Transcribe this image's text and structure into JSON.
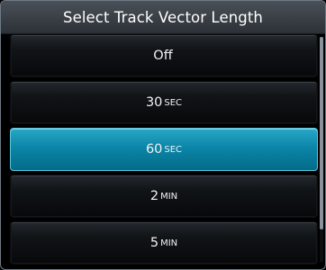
{
  "dialog": {
    "title": "Select Track Vector Length"
  },
  "options": [
    {
      "num": "Off",
      "unit": "",
      "selected": false
    },
    {
      "num": "30",
      "unit": "SEC",
      "selected": false
    },
    {
      "num": "60",
      "unit": "SEC",
      "selected": true
    },
    {
      "num": "2",
      "unit": "MIN",
      "selected": false
    },
    {
      "num": "5",
      "unit": "MIN",
      "selected": false
    }
  ],
  "colors": {
    "selected_fill": "#0b86a8",
    "button_fill": "#111417",
    "titlebar_fill": "#3b4046"
  }
}
